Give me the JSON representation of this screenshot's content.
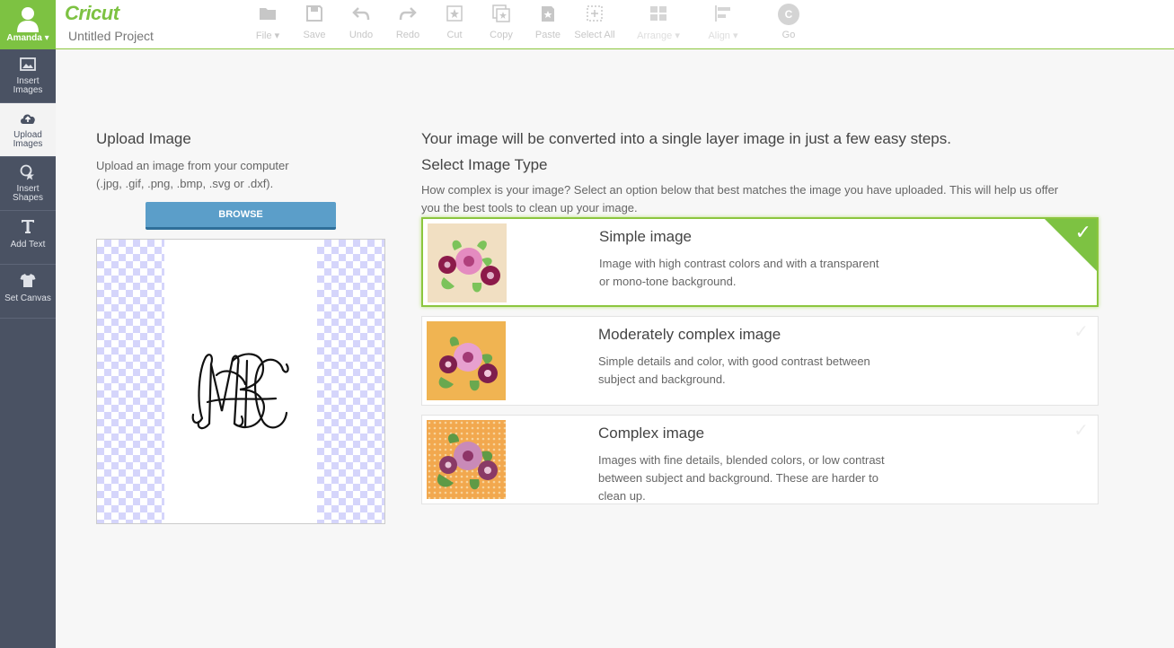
{
  "app": {
    "user_name": "Amanda",
    "logo_text": "Cricut",
    "project_name": "Untitled Project"
  },
  "toolbar": {
    "items": [
      {
        "label": "File",
        "icon": "folder-icon"
      },
      {
        "label": "Save",
        "icon": "save-icon"
      },
      {
        "label": "Undo",
        "icon": "undo-icon"
      },
      {
        "label": "Redo",
        "icon": "redo-icon"
      },
      {
        "label": "Cut",
        "icon": "cut-icon"
      },
      {
        "label": "Copy",
        "icon": "copy-icon"
      },
      {
        "label": "Paste",
        "icon": "paste-icon"
      },
      {
        "label": "Select All",
        "icon": "select-all-icon"
      },
      {
        "label": "Arrange",
        "icon": "arrange-icon"
      },
      {
        "label": "Align",
        "icon": "align-icon"
      },
      {
        "label": "Go",
        "icon": "go-icon",
        "glyph": "C"
      }
    ]
  },
  "sidebar": {
    "items": [
      {
        "label_line1": "Insert",
        "label_line2": "Images",
        "icon": "image-icon"
      },
      {
        "label_line1": "Upload",
        "label_line2": "Images",
        "icon": "cloud-upload-icon"
      },
      {
        "label_line1": "Insert",
        "label_line2": "Shapes",
        "icon": "shapes-icon"
      },
      {
        "label_line1": "Add Text",
        "label_line2": "",
        "icon": "text-icon"
      },
      {
        "label_line1": "Set Canvas",
        "label_line2": "",
        "icon": "shirt-icon"
      }
    ]
  },
  "upload": {
    "title": "Upload Image",
    "desc_line1": "Upload an image from your computer",
    "desc_line2": "(.jpg, .gif, .png, .bmp, .svg or .dxf).",
    "browse_label": "BROWSE"
  },
  "main": {
    "intro": "Your image will be converted into a single layer image in just a few easy steps.",
    "select_title": "Select Image Type",
    "help_line1": "How complex is your image? Select an option below that best matches the image you have uploaded. This will help us offer",
    "help_line2": "you the best tools to clean up your image."
  },
  "options": [
    {
      "title": "Simple image",
      "desc_line1": "Image with high contrast colors and with a transparent",
      "desc_line2": "or mono-tone background.",
      "desc_line3": "",
      "selected": true
    },
    {
      "title": "Moderately complex image",
      "desc_line1": "Simple details and color, with good contrast between",
      "desc_line2": "subject and background.",
      "desc_line3": "",
      "selected": false
    },
    {
      "title": "Complex image",
      "desc_line1": "Images with fine details, blended colors, or low contrast",
      "desc_line2": "between subject and background. These are harder to",
      "desc_line3": "clean up.",
      "selected": false
    }
  ],
  "colors": {
    "accent": "#7dc242",
    "sidebar": "#4a5263",
    "browse": "#5b9ec9"
  }
}
